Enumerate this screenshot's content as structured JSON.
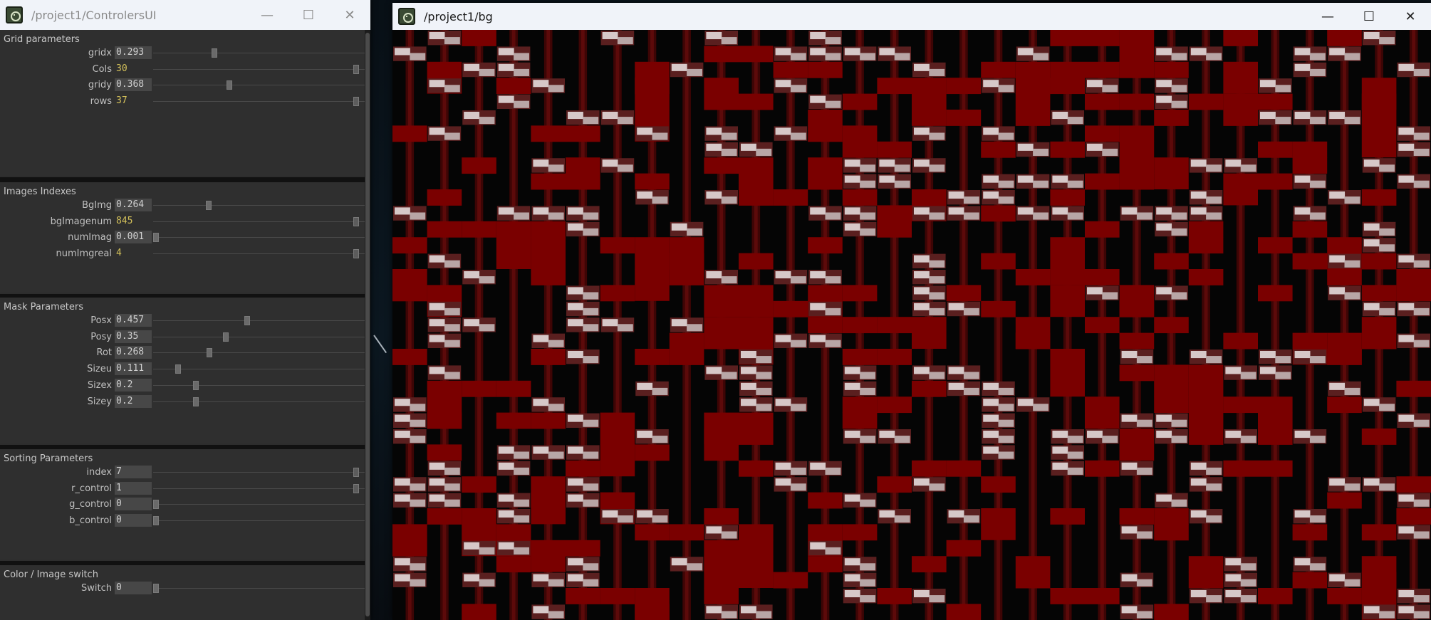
{
  "controllers_window": {
    "title": "/project1/ControlersUI",
    "controls": {
      "minimize": "—",
      "maximize": "☐",
      "close": "✕"
    },
    "groups": [
      {
        "title": "Grid parameters",
        "rows": [
          {
            "label": "gridx",
            "value": "0.293",
            "level": 0.293,
            "type": "float"
          },
          {
            "label": "Cols",
            "value": "30",
            "level": 1.0,
            "type": "int"
          },
          {
            "label": "gridy",
            "value": "0.368",
            "level": 0.368,
            "type": "float"
          },
          {
            "label": "rows",
            "value": "37",
            "level": 1.0,
            "type": "int"
          }
        ]
      },
      {
        "title": "Images Indexes",
        "rows": [
          {
            "label": "BgImg",
            "value": "0.264",
            "level": 0.264,
            "type": "float"
          },
          {
            "label": "bgImagenum",
            "value": "845",
            "level": 1.0,
            "type": "int"
          },
          {
            "label": "numImag",
            "value": "0.001",
            "level": 0.001,
            "type": "float"
          },
          {
            "label": "numImgreal",
            "value": "4",
            "level": 1.0,
            "type": "int"
          }
        ]
      },
      {
        "title": "Mask Parameters",
        "rows": [
          {
            "label": "Posx",
            "value": "0.457",
            "level": 0.457,
            "type": "float"
          },
          {
            "label": "Posy",
            "value": "0.35",
            "level": 0.35,
            "type": "float"
          },
          {
            "label": "Rot",
            "value": "0.268",
            "level": 0.268,
            "type": "float"
          },
          {
            "label": "Sizeu",
            "value": "0.111",
            "level": 0.111,
            "type": "float"
          },
          {
            "label": "Sizex",
            "value": "0.2",
            "level": 0.2,
            "type": "float"
          },
          {
            "label": "Sizey",
            "value": "0.2",
            "level": 0.2,
            "type": "float"
          }
        ]
      },
      {
        "title": "Sorting Parameters",
        "rows": [
          {
            "label": "index",
            "value": "7",
            "level": 1.0,
            "type": "float"
          },
          {
            "label": "r_control",
            "value": "1",
            "level": 1.0,
            "type": "float"
          },
          {
            "label": "g_control",
            "value": "0",
            "level": 0.0,
            "type": "float"
          },
          {
            "label": "b_control",
            "value": "0",
            "level": 0.0,
            "type": "float"
          }
        ]
      },
      {
        "title": "Color / Image switch",
        "rows": [
          {
            "label": "Switch",
            "value": "0",
            "level": 0.0,
            "type": "float"
          }
        ]
      }
    ]
  },
  "bg_window": {
    "title": "/project1/bg",
    "controls": {
      "minimize": "—",
      "maximize": "☐",
      "close": "✕"
    },
    "pattern_colors": {
      "red": "#7a0000",
      "dark_red": "#3d0505",
      "black": "#050505",
      "tile_light": "#d6c8c8",
      "tile_dark": "#5a1f1f"
    }
  }
}
